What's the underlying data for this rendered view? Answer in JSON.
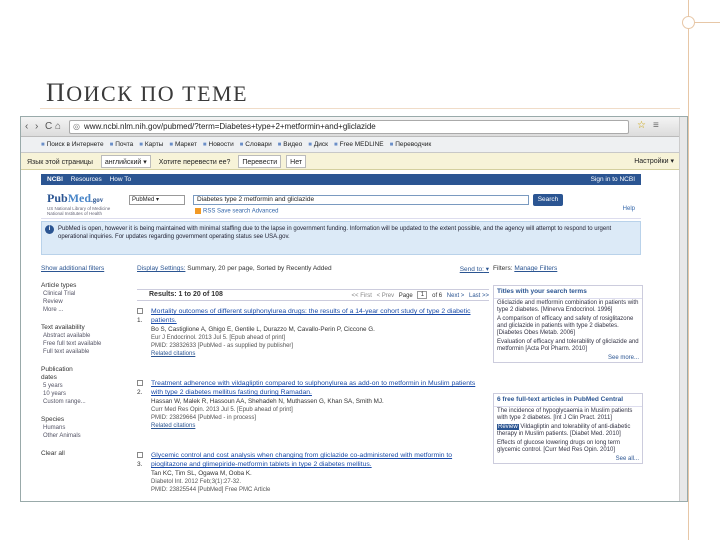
{
  "slide": {
    "title_first": "П",
    "title_rest": "оиск по теме"
  },
  "browser": {
    "back": "‹",
    "forward": "›",
    "reload": "C",
    "home": "⌂",
    "url": "www.ncbi.nlm.nih.gov/pubmed/?term=Diabetes+type+2+metformin+and+gliclazide",
    "bookmarks": [
      "Поиск в Интернете",
      "Почта",
      "Карты",
      "Маркет",
      "Новости",
      "Словари",
      "Видео",
      "Диск",
      "Free MEDLINE",
      "Переводчик"
    ],
    "translate": {
      "label": "Язык этой страницы",
      "lang": "английский",
      "question": "Хотите перевести ее?",
      "translate_btn": "Перевести",
      "no_btn": "Нет",
      "settings": "Настройки"
    }
  },
  "ncbi": {
    "logo": "NCBI",
    "resources": "Resources",
    "howto": "How To",
    "signin": "Sign in to NCBI"
  },
  "pubmed": {
    "logo_pub": "Pub",
    "logo_med": "Med",
    "logo_gov": ".gov",
    "logo_sub": "US National Library of Medicine National Institutes of Health",
    "db": "PubMed",
    "query": "Diabetes type 2 metformin and gliclazide",
    "search_btn": "Search",
    "rss": "RSS",
    "save_search": "Save search",
    "advanced": "Advanced",
    "help": "Help"
  },
  "notice": "PubMed is open, however it is being maintained with minimal staffing due to the lapse in government funding. Information will be updated to the extent possible, and the agency will attempt to respond to urgent operational inquiries. For updates regarding government operating status see USA.gov.",
  "sidebar": {
    "show_filters": "Show additional filters",
    "groups": [
      {
        "title": "Article types",
        "items": [
          "Clinical Trial",
          "Review",
          "More ..."
        ]
      },
      {
        "title": "Text availability",
        "items": [
          "Abstract available",
          "Free full text available",
          "Full text available"
        ]
      },
      {
        "title": "Publication dates",
        "items": [
          "5 years",
          "10 years",
          "Custom range..."
        ]
      },
      {
        "title": "Species",
        "items": [
          "Humans",
          "Other Animals"
        ]
      },
      {
        "title": "Clear all",
        "items": []
      }
    ]
  },
  "display": {
    "settings_label": "Display Settings:",
    "settings_value": "Summary, 20 per page, Sorted by Recently Added",
    "send_to": "Send to:"
  },
  "results": {
    "summary": "Results: 1 to 20 of 108",
    "first": "<< First",
    "prev": "< Prev",
    "page_label": "Page",
    "page": "1",
    "of": "of 6",
    "next": "Next >",
    "last": "Last >>"
  },
  "records": [
    {
      "num": "1.",
      "title": "Mortality outcomes of different sulphonylurea drugs: the results of a 14-year cohort study of type 2 diabetic patients.",
      "authors": "Bo S, Castiglione A, Ghigo E, Gentile L, Durazzo M, Cavallo-Perin P, Ciccone G.",
      "journal": "Eur J Endocrinol. 2013 Jul 5. [Epub ahead of print]",
      "pmid": "PMID: 23832633 [PubMed - as supplied by publisher]",
      "related": "Related citations"
    },
    {
      "num": "2.",
      "title": "Treatment adherence with vildagliptin compared to sulphonylurea as add-on to metformin in Muslim patients with type 2 diabetes mellitus fasting during Ramadan.",
      "authors": "Hassan W, Malek R, Hassoun AA, Shehadeh N, Muthassen G, Khan SA, Smith MJ.",
      "journal": "Curr Med Res Opin. 2013 Jul 5. [Epub ahead of print]",
      "pmid": "PMID: 23829664 [PubMed - in process]",
      "related": "Related citations"
    },
    {
      "num": "3.",
      "title": "Glycemic control and cost analysis when changing from gliclazide co-administered with metformin to pioglitazone and glimepiride-metformin tablets in type 2 diabetes mellitus.",
      "authors": "Tan KC, Tim SL, Ogawa M, Ooba K.",
      "journal": "Diabetol Int. 2012 Feb;3(1):27-32.",
      "pmid": "PMID: 23825544 [PubMed] Free PMC Article",
      "related": "Related citations"
    }
  ],
  "rightcol": {
    "filters_label": "Filters:",
    "manage_filters": "Manage Filters",
    "titles_box": {
      "head": "Titles with your search terms",
      "items": [
        "Gliclazide and metformin combination in patients with type 2 diabetes. [Minerva Endocrinol. 1996]",
        "A comparison of efficacy and safety of rosiglitazone and gliclazide in patients with type 2 diabetes. [Diabetes Obes Metab. 2006]",
        "Evaluation of efficacy and tolerability of gliclazide and metformin [Acta Pol Pharm. 2010]"
      ],
      "more": "See more..."
    },
    "free_box": {
      "head": "6 free full-text articles in PubMed Central",
      "items": [
        "The incidence of hypoglycaemia in Muslim patients with type 2 diabetes. [Int J Clin Pract. 2011]",
        "Vildagliptin and tolerability of anti-diabetic therapy in Muslim patients. [Diabet Med. 2010]",
        "Effects of glucose lowering drugs on long term glycemic control. [Curr Med Res Opin. 2010]"
      ],
      "highlight": "Review",
      "more": "See all..."
    }
  }
}
